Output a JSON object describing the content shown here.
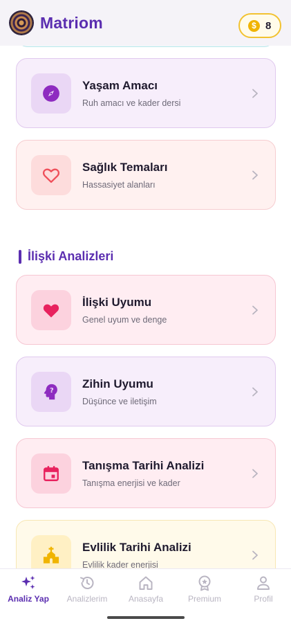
{
  "header": {
    "app_title": "Matriom",
    "coin_symbol": "$",
    "coin_count": "8",
    "logo_icon": "spiral-logo"
  },
  "cards_top": [
    {
      "title": "Yaşam Amacı",
      "subtitle": "Ruh amacı ve kader dersi",
      "icon": "compass-icon",
      "bg": "#f7eefb",
      "border": "#e0c9ee",
      "icon_bg": "#ead7f5",
      "icon_color": "#8e2cc0"
    },
    {
      "title": "Sağlık Temaları",
      "subtitle": "Hassasiyet alanları",
      "icon": "heart-outline-icon",
      "bg": "#fff1f0",
      "border": "#f6cdd0",
      "icon_bg": "#fddcdc",
      "icon_color": "#ef4f5a"
    }
  ],
  "section": {
    "title": "İlişki Analizleri"
  },
  "cards_relationship": [
    {
      "title": "İlişki Uyumu",
      "subtitle": "Genel uyum ve denge",
      "icon": "heart-filled-icon",
      "bg": "#ffedf2",
      "border": "#f6c6d2",
      "icon_bg": "#fcd2de",
      "icon_color": "#e8225e"
    },
    {
      "title": "Zihin Uyumu",
      "subtitle": "Düşünce ve iletişim",
      "icon": "mind-icon",
      "bg": "#f7eefb",
      "border": "#e0c9ee",
      "icon_bg": "#ead7f5",
      "icon_color": "#8e2cc0"
    },
    {
      "title": "Tanışma Tarihi Analizi",
      "subtitle": "Tanışma enerjisi ve kader",
      "icon": "calendar-icon",
      "bg": "#ffedf2",
      "border": "#f6c6d2",
      "icon_bg": "#fcd2de",
      "icon_color": "#e8225e"
    },
    {
      "title": "Evlilik Tarihi Analizi",
      "subtitle": "Evlilik kader enerjisi",
      "icon": "church-icon",
      "bg": "#fffaea",
      "border": "#f7e7b4",
      "icon_bg": "#fff0c4",
      "icon_color": "#f0b400"
    }
  ],
  "bottom_nav": [
    {
      "label": "Analiz Yap",
      "icon": "sparkles-icon",
      "active": true
    },
    {
      "label": "Analizlerim",
      "icon": "history-icon",
      "active": false
    },
    {
      "label": "Anasayfa",
      "icon": "home-icon",
      "active": false
    },
    {
      "label": "Premium",
      "icon": "premium-badge-icon",
      "active": false
    },
    {
      "label": "Profil",
      "icon": "person-icon",
      "active": false
    }
  ],
  "colors": {
    "brand": "#5b2eb0",
    "nav_inactive": "#b9b5c2"
  }
}
